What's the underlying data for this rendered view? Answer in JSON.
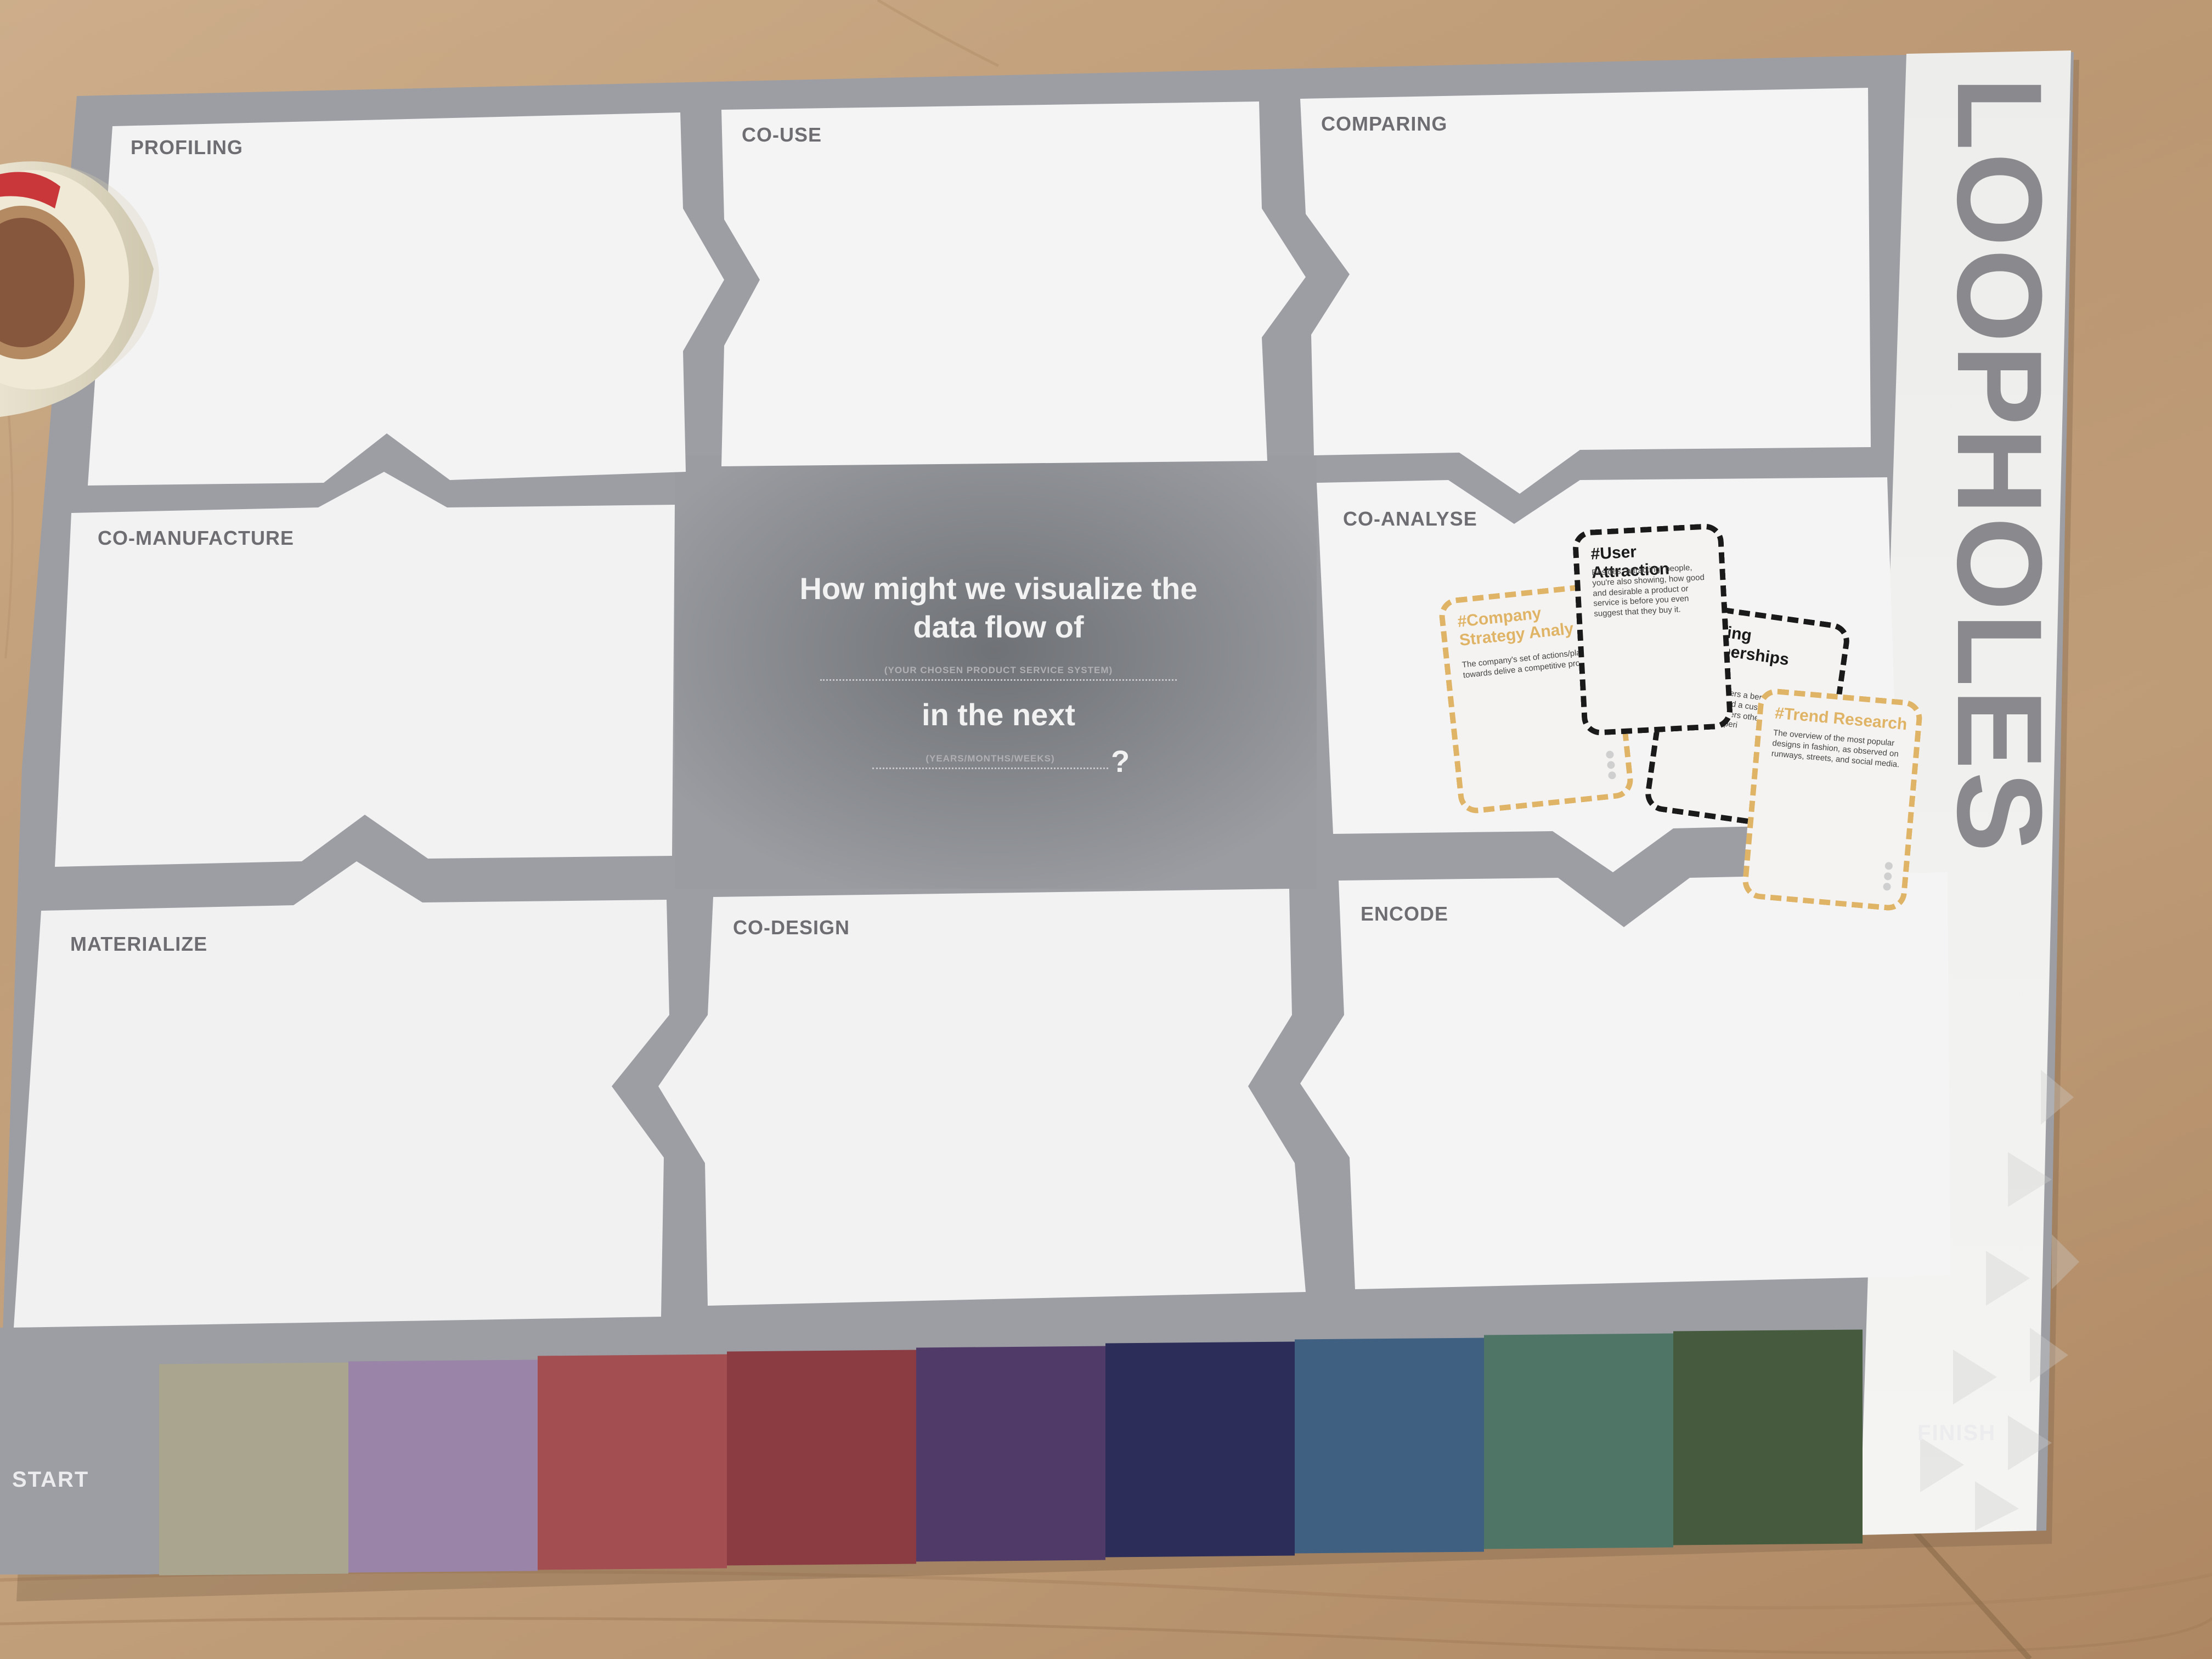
{
  "brand": {
    "title": "LOOPHOLES"
  },
  "stages": {
    "profiling": "PROFILING",
    "co_use": "CO-USE",
    "comparing": "COMPARING",
    "co_manufacture": "CO-MANUFACTURE",
    "co_analyse": "CO-ANALYSE",
    "materialize": "MATERIALIZE",
    "co_design": "CO-DESIGN",
    "encode": "ENCODE"
  },
  "question": {
    "line1": "How might we visualize the",
    "line2": "data flow of",
    "hint1": "(YOUR CHOSEN PRODUCT SERVICE SYSTEM)",
    "line3": "in the next",
    "hint2": "(YEARS/MONTHS/WEEKS)",
    "mark": "?"
  },
  "timeline": {
    "start": "START",
    "finish": "FINISH",
    "swatches": [
      "#a9a58e",
      "#9a84a8",
      "#a34e50",
      "#8a3c42",
      "#4f3a68",
      "#2c2d58",
      "#3f6080",
      "#4f7566",
      "#465a3e"
    ]
  },
  "cards": [
    {
      "title": "#Company Strategy Analy",
      "description": "The company's set of actions/plans towards delive a competitive product.",
      "style": "gold",
      "accent": "#e0b466"
    },
    {
      "title": "#User Attraction",
      "description": "Besides \"attracting\" people, you're also showing, how good and desirable a product or service is before you even suggest that they buy it.",
      "style": "black",
      "accent": "#1a1a1a"
    },
    {
      "title": "#Making Memberships Count",
      "description": "Giving customers a benefits through m can help to build a customer base inc create a members other value would customer's experi",
      "style": "black",
      "accent": "#1a1a1a"
    },
    {
      "title": "#Trend Research",
      "description": "The overview of the most popular designs in fashion, as observed on runways, streets, and social media.",
      "style": "gold",
      "accent": "#e0b466"
    }
  ]
}
